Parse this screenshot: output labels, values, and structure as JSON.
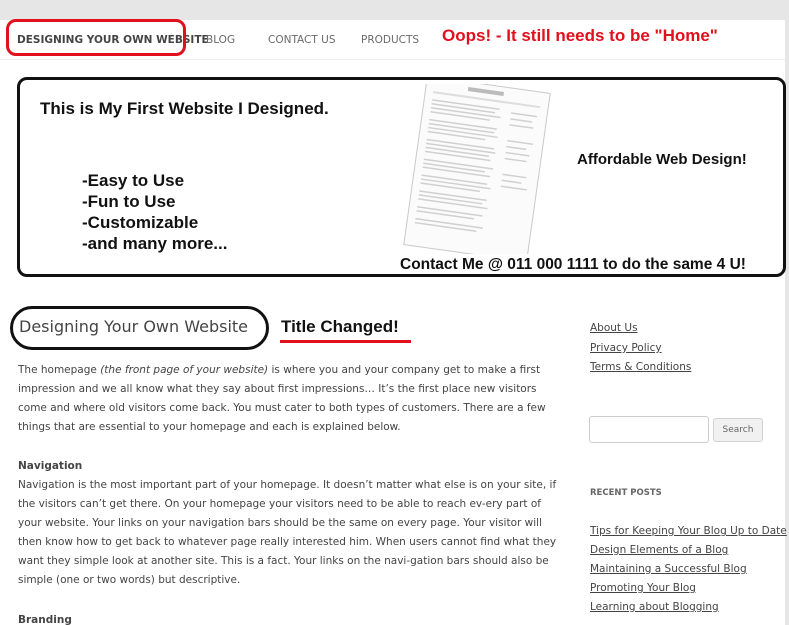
{
  "nav": {
    "items": [
      {
        "label": "DESIGNING YOUR OWN WEBSITE"
      },
      {
        "label": "BLOG"
      },
      {
        "label": "CONTACT US"
      },
      {
        "label": "PRODUCTS"
      }
    ],
    "annotation": "Oops! - It still needs to be \"Home\""
  },
  "banner": {
    "title": "This is My First Website I Designed.",
    "features": [
      "-Easy to Use",
      "-Fun to Use",
      "-Customizable",
      "-and many more..."
    ],
    "tagline": "Affordable Web Design!",
    "contact": "Contact Me @ 011 000 1111 to do the same 4 U!"
  },
  "main": {
    "title": "Designing Your Own Website",
    "title_annotation": "Title Changed!",
    "intro_before": "The homepage ",
    "intro_em": "(the front page of your website)",
    "intro_after": " is where you and your company get to make a first impression and we all know what they say about first impressions… It’s the first place new visitors come and where old visitors come back. You must cater to both types of customers. There are a few things that are essential to your homepage and each is explained below.",
    "sections": [
      {
        "heading": "Navigation",
        "body": "Navigation is the most important part of your homepage. It doesn’t matter what else is on your site, if the visitors can’t get there. On your homepage your visitors need to be able to reach ev-ery part of your website. Your links on your navigation bars should be the same on every page. Your visitor will then know how to get back to whatever page really interested him. When users cannot find what they want they simple look at another site. This is a fact. Your links on the navi-gation bars should also be simple (one or two words) but descriptive."
      },
      {
        "heading": "Branding",
        "body": ""
      }
    ]
  },
  "sidebar": {
    "links": [
      "About Us",
      "Privacy Policy",
      "Terms & Conditions"
    ],
    "search": {
      "placeholder": "",
      "button_label": "Search"
    },
    "recent_posts_heading": "RECENT POSTS",
    "recent_posts": [
      "Tips for Keeping Your Blog Up to Date",
      "Design Elements of a Blog",
      "Maintaining a Successful Blog",
      "Promoting Your Blog",
      "Learning about Blogging"
    ]
  },
  "colors": {
    "annotation_red": "#e0101d",
    "text": "#444444",
    "background": "#e6e6e6"
  }
}
